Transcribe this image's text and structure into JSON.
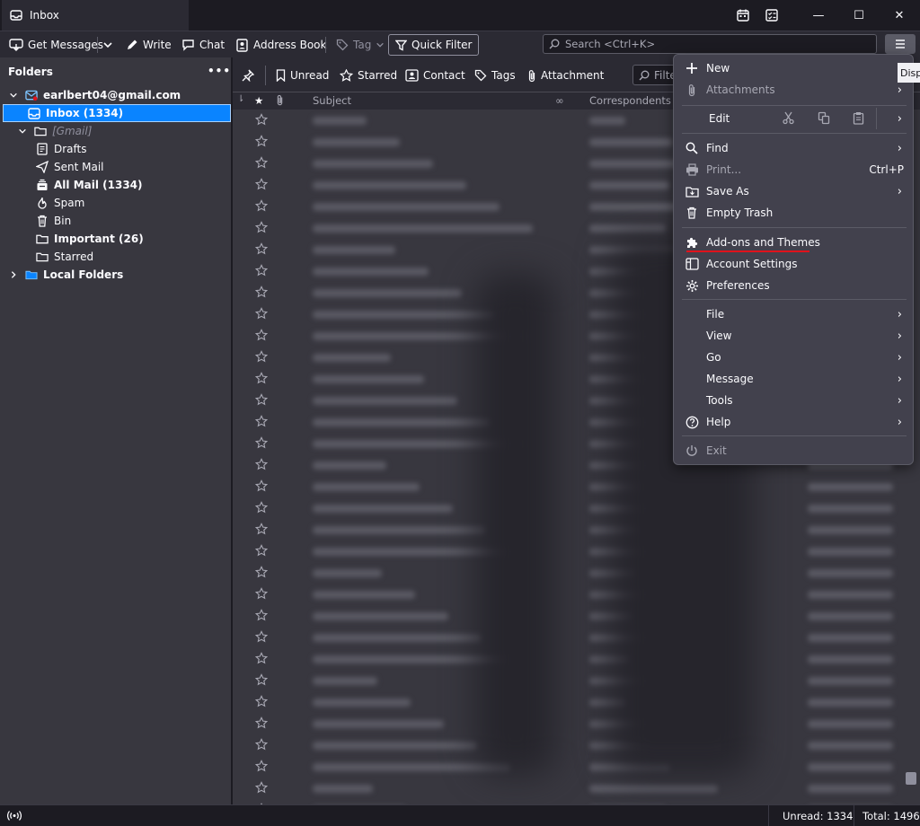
{
  "window": {
    "tab_title": "Inbox",
    "minimize": "—",
    "maximize": "☐",
    "close": "✕"
  },
  "toolbar": {
    "get_messages": "Get Messages",
    "write": "Write",
    "chat": "Chat",
    "address_book": "Address Book",
    "tag": "Tag",
    "quick_filter": "Quick Filter",
    "search_placeholder": "Search <Ctrl+K>"
  },
  "folders": {
    "header": "Folders",
    "more": "•••",
    "account": "earlbert04@gmail.com",
    "inbox": "Inbox (1334)",
    "gmail": "[Gmail]",
    "drafts": "Drafts",
    "sent": "Sent Mail",
    "all_mail": "All Mail (1334)",
    "spam": "Spam",
    "bin": "Bin",
    "important": "Important (26)",
    "starred": "Starred",
    "local_folders": "Local Folders"
  },
  "quickfilter": {
    "unread": "Unread",
    "starred": "Starred",
    "contact": "Contact",
    "tags": "Tags",
    "attachment": "Attachment",
    "filter_placeholder": "Filte"
  },
  "columns": {
    "subject": "Subject",
    "correspondents": "Correspondents"
  },
  "appmenu": {
    "new": "New",
    "attachments": "Attachments",
    "edit": "Edit",
    "find": "Find",
    "print": "Print...",
    "print_shortcut": "Ctrl+P",
    "save_as": "Save As",
    "empty_trash": "Empty Trash",
    "addons": "Add-ons and Themes",
    "account_settings": "Account Settings",
    "preferences": "Preferences",
    "file": "File",
    "view": "View",
    "go": "Go",
    "message": "Message",
    "tools": "Tools",
    "help": "Help",
    "exit": "Exit"
  },
  "tooltip": "Disp",
  "status": {
    "unread": "Unread: 1334",
    "total": "Total: 1496"
  },
  "colors": {
    "accent": "#0a84ff",
    "highlight_underline": "#e0121b"
  }
}
